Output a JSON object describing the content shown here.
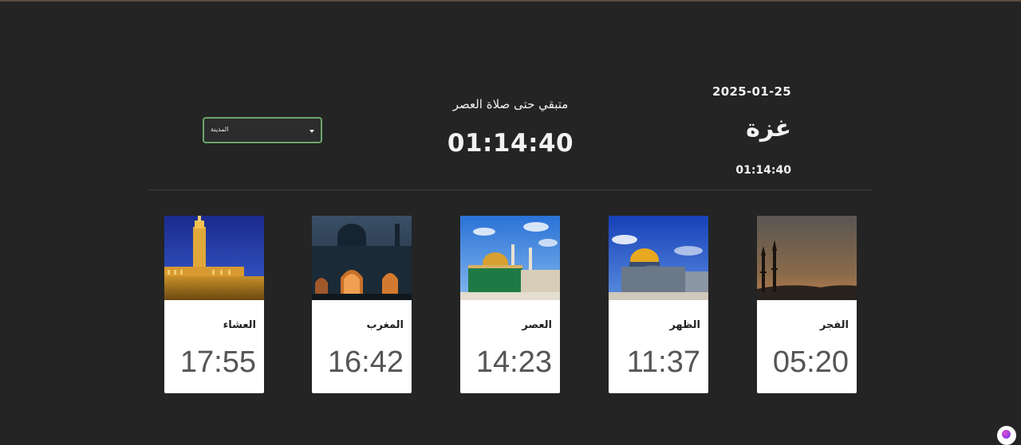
{
  "header": {
    "date": "2025-01-25",
    "city": "غزة",
    "clock": "01:14:40"
  },
  "countdown": {
    "label": "متبقي حتى صلاة العصر",
    "value": "01:14:40"
  },
  "city_select": {
    "selected": "المدينة"
  },
  "prayers": [
    {
      "name": "الفجر",
      "time": "05:20",
      "image_icon": "minarets-dawn-image"
    },
    {
      "name": "الظهر",
      "time": "11:37",
      "image_icon": "dome-of-rock-day-image"
    },
    {
      "name": "العصر",
      "time": "14:23",
      "image_icon": "mosque-green-dome-image"
    },
    {
      "name": "المغرب",
      "time": "16:42",
      "image_icon": "mosque-arches-dusk-image"
    },
    {
      "name": "العشاء",
      "time": "17:55",
      "image_icon": "mosque-minaret-night-image"
    }
  ],
  "colors": {
    "background": "#242424",
    "card": "#ffffff",
    "select_border": "#6aa86a"
  }
}
